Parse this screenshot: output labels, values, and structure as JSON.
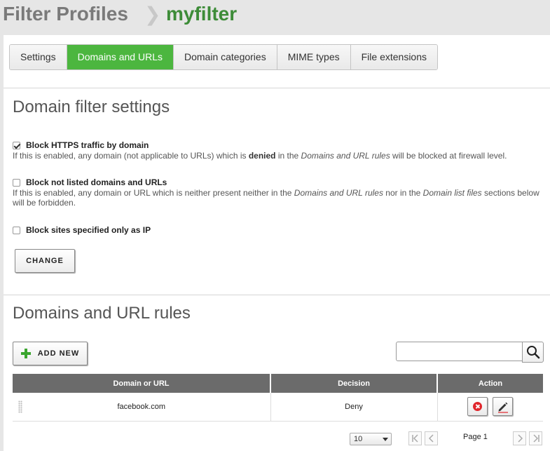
{
  "breadcrumb": {
    "root": "Filter Profiles",
    "separator": "❯",
    "current": "myfilter"
  },
  "tabs": [
    {
      "label": "Settings",
      "active": false
    },
    {
      "label": "Domains and URLs",
      "active": true
    },
    {
      "label": "Domain categories",
      "active": false
    },
    {
      "label": "MIME types",
      "active": false
    },
    {
      "label": "File extensions",
      "active": false
    }
  ],
  "domain_filter": {
    "title": "Domain filter settings",
    "options": [
      {
        "label": "Block HTTPS traffic by domain",
        "checked": true,
        "desc": {
          "pre": "If this is enabled, any domain (not applicable to URLs) which is ",
          "bold": "denied",
          "mid": " in the ",
          "em": "Domains and URL rules",
          "post": " will be blocked at firewall level."
        }
      },
      {
        "label": "Block not listed domains and URLs",
        "checked": false,
        "desc": {
          "pre": "If this is enabled, any domain or URL which is neither present neither in the ",
          "em1": "Domains and URL rules",
          "mid": " nor in the ",
          "em2": "Domain list files",
          "post": " sections below will be forbidden."
        }
      },
      {
        "label": "Block sites specified only as IP",
        "checked": false
      }
    ],
    "change_label": "CHANGE"
  },
  "rules": {
    "title": "Domains and URL rules",
    "add_label": "ADD NEW",
    "search_placeholder": "",
    "columns": [
      "Domain or URL",
      "Decision",
      "Action"
    ],
    "rows": [
      {
        "domain": "facebook.com",
        "decision": "Deny"
      }
    ],
    "pager": {
      "page_size": "10",
      "page_label": "Page 1"
    }
  },
  "colors": {
    "accent": "#4cb63f",
    "title_green": "#3d8c38",
    "header_gray": "#6b6b6b",
    "delete_red": "#e0252b"
  },
  "icons": [
    "checkbox-icon",
    "plus-icon",
    "search-icon",
    "drag-handle-icon",
    "delete-icon",
    "edit-pencil-icon",
    "first-page-icon",
    "prev-page-icon",
    "next-page-icon",
    "last-page-icon",
    "caret-down-icon"
  ]
}
